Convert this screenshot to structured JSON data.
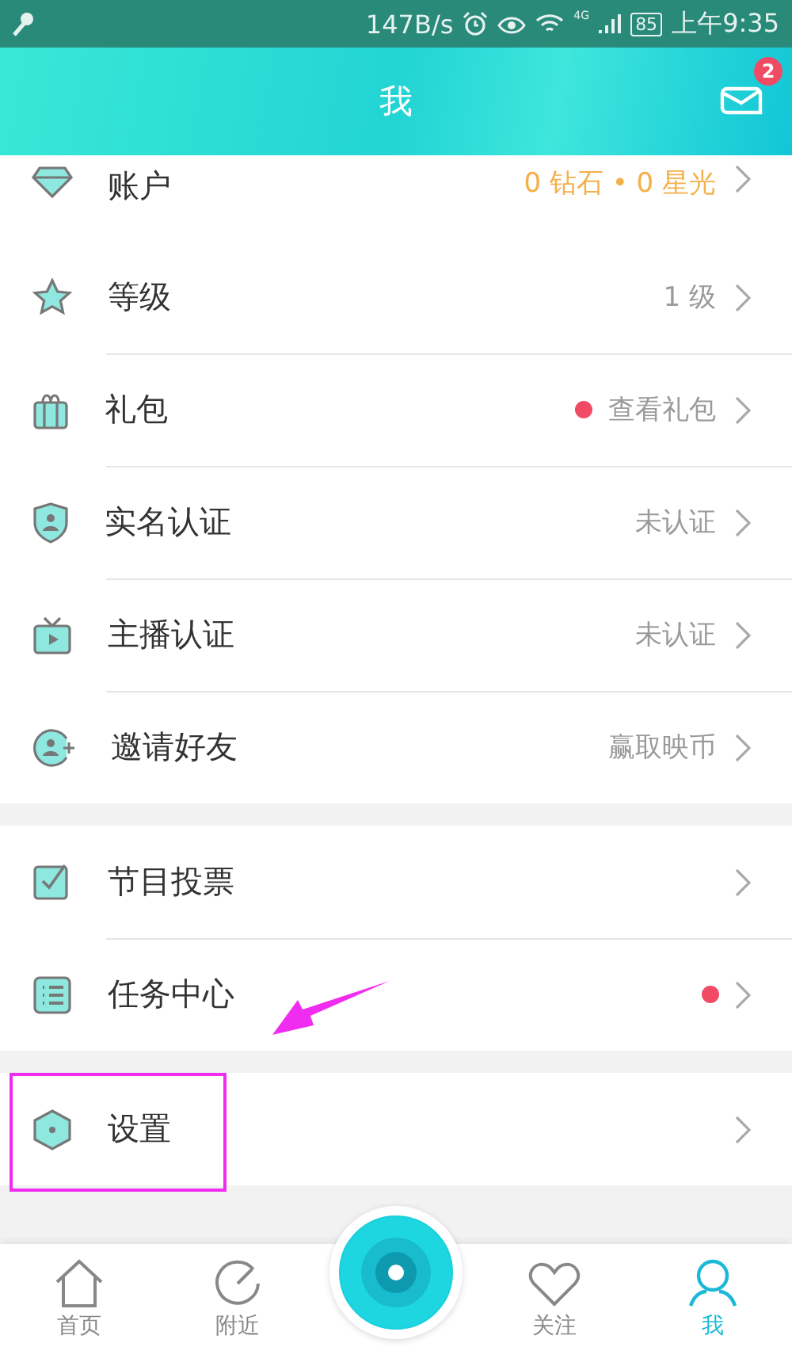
{
  "status_bar": {
    "network_speed": "147B/s",
    "network_type": "4G",
    "battery": "85",
    "time": "上午9:35"
  },
  "header": {
    "title": "我",
    "unread_badge": "2"
  },
  "groups": [
    [
      {
        "label": "账户",
        "value": "0 钻石 • 0 星光",
        "accent": true,
        "dot": false,
        "annotated": false,
        "cut": true
      },
      {
        "label": "等级",
        "value": "1 级",
        "accent": false,
        "dot": false,
        "annotated": false,
        "cut": false
      },
      {
        "label": "礼包",
        "value": "查看礼包",
        "accent": false,
        "dot": true,
        "annotated": false,
        "cut": false
      },
      {
        "label": "实名认证",
        "value": "未认证",
        "accent": false,
        "dot": false,
        "annotated": false,
        "cut": false
      },
      {
        "label": "主播认证",
        "value": "未认证",
        "accent": false,
        "dot": false,
        "annotated": false,
        "cut": false
      },
      {
        "label": "邀请好友",
        "value": "赢取映币",
        "accent": false,
        "dot": false,
        "annotated": false,
        "cut": false
      }
    ],
    [
      {
        "label": "节目投票",
        "dot": false,
        "annotated": false,
        "cut": false
      },
      {
        "label": "任务中心",
        "dot": true,
        "annotated": false,
        "cut": false
      }
    ],
    [
      {
        "label": "设置",
        "dot": false,
        "annotated": true,
        "cut": false
      }
    ]
  ],
  "tab_bar": [
    {
      "label": "首页",
      "selected": false
    },
    {
      "label": "附近",
      "selected": false
    },
    {
      "kind": "record"
    },
    {
      "label": "关注",
      "selected": false
    },
    {
      "label": "我",
      "selected": true
    }
  ]
}
